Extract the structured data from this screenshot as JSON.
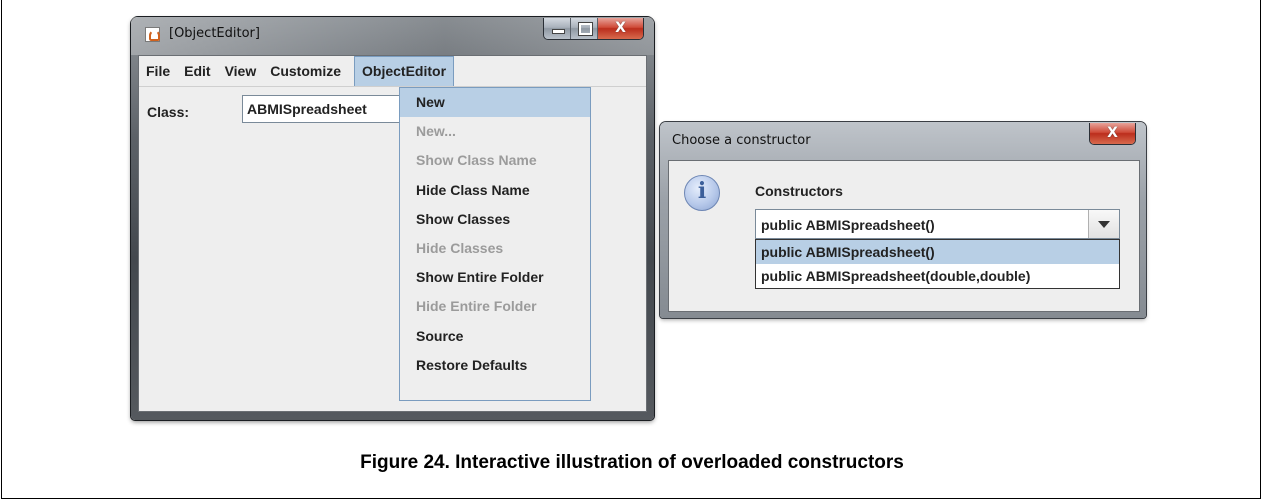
{
  "main_window": {
    "title": "[ObjectEditor]",
    "icon": "java-coffee-icon",
    "menubar": [
      "File",
      "Edit",
      "View",
      "Customize",
      "ObjectEditor"
    ],
    "class_label": "Class:",
    "class_value": "ABMISpreadsheet",
    "objecteditor_menu": [
      {
        "label": "New",
        "enabled": true,
        "highlighted": true
      },
      {
        "label": "New...",
        "enabled": false
      },
      {
        "label": "Show Class Name",
        "enabled": false
      },
      {
        "label": "Hide Class Name",
        "enabled": true
      },
      {
        "label": "Show Classes",
        "enabled": true
      },
      {
        "label": "Hide Classes",
        "enabled": false
      },
      {
        "label": "Show Entire Folder",
        "enabled": true
      },
      {
        "label": "Hide Entire Folder",
        "enabled": false
      },
      {
        "label": "Source",
        "enabled": true
      },
      {
        "label": "Restore Defaults",
        "enabled": true
      }
    ]
  },
  "dialog": {
    "title": "Choose a constructor",
    "close_label": "X",
    "icon": "info-icon",
    "constructors_label": "Constructors",
    "selected": "public ABMISpreadsheet()",
    "options": [
      "public ABMISpreadsheet()",
      "public ABMISpreadsheet(double,double)"
    ]
  },
  "caption": "Figure 24. Interactive illustration of overloaded constructors",
  "colors": {
    "selection": "#b8cfe5",
    "close_button": "#c8412e",
    "disabled_text": "#9b9b9b"
  }
}
